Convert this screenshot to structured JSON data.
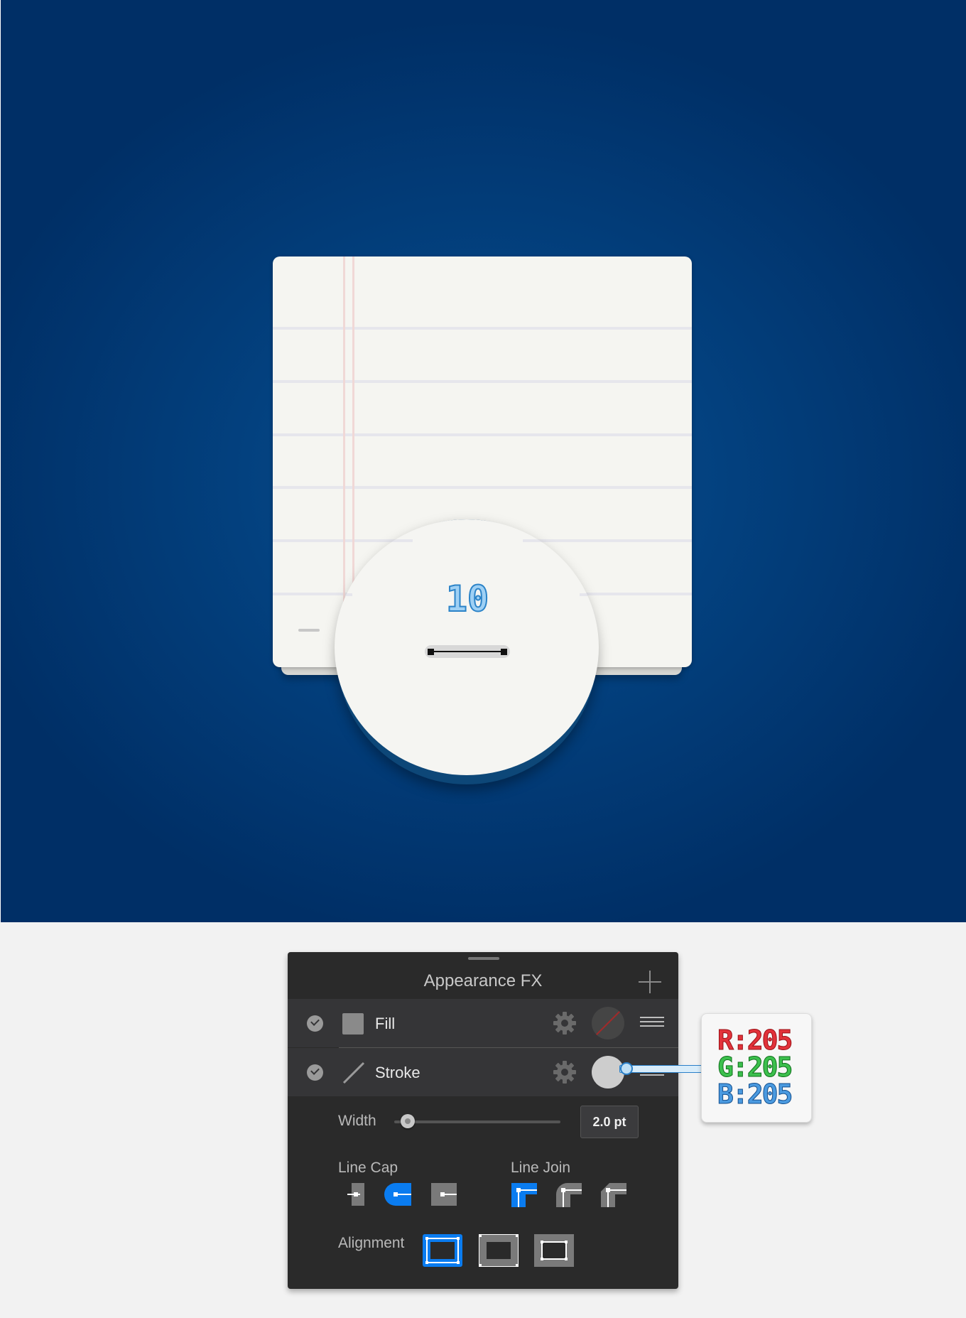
{
  "canvas": {
    "background_color": "#03417f",
    "notepad": {
      "paper_color": "#f5f5f1",
      "rule_color": "#e6e6ec",
      "margin_color": "#f0d8d6"
    },
    "zoom": {
      "number": "10",
      "number_color": "#2b83c8"
    }
  },
  "panel": {
    "title": "Appearance FX",
    "add_icon": "plus-icon",
    "rows": [
      {
        "label": "Fill",
        "checked": true,
        "icon": "fill-square-icon",
        "color": "none"
      },
      {
        "label": "Stroke",
        "checked": true,
        "icon": "stroke-line-icon",
        "color": "#cdcdcd"
      }
    ],
    "width": {
      "label": "Width",
      "value": "2.0 pt",
      "slider_fraction": 0.08
    },
    "line_cap": {
      "label": "Line Cap",
      "options": [
        "butt-cap",
        "round-cap",
        "projecting-cap"
      ],
      "selected": "round-cap"
    },
    "line_join": {
      "label": "Line Join",
      "options": [
        "miter-join",
        "round-join",
        "bevel-join"
      ],
      "selected": "miter-join"
    },
    "alignment": {
      "label": "Alignment",
      "options": [
        "align-center",
        "align-inside",
        "align-outside"
      ],
      "selected": "align-center"
    },
    "accent_color": "#0a7cf0"
  },
  "callout": {
    "r": "R:205",
    "g": "G:205",
    "b": "B:205"
  }
}
